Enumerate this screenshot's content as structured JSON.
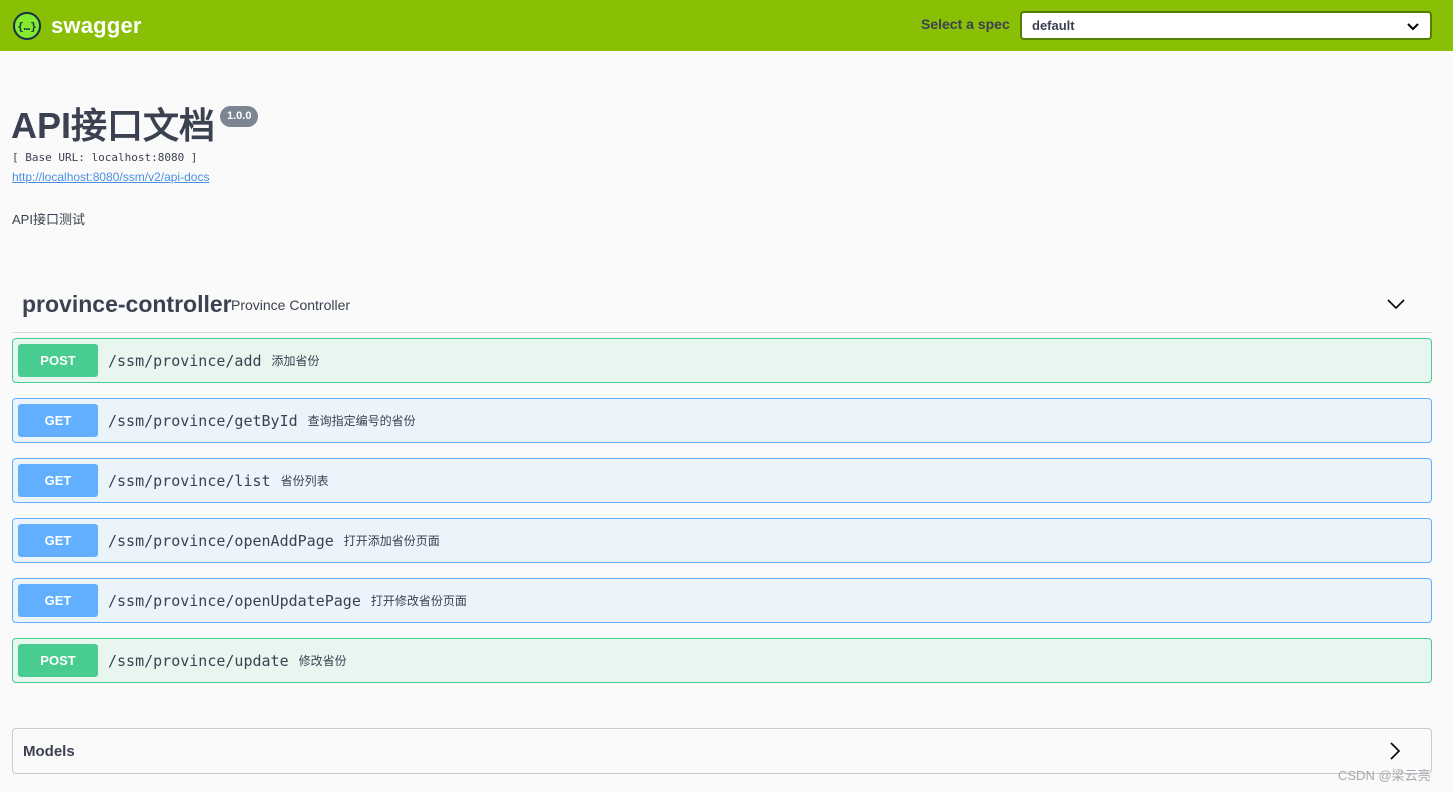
{
  "topbar": {
    "logo_text": "swagger",
    "spec_label": "Select a spec",
    "spec_value": "default"
  },
  "info": {
    "title": "API接口文档",
    "version": "1.0.0",
    "base_url": "[ Base URL: localhost:8080 ]",
    "docs_link": "http://localhost:8080/ssm/v2/api-docs",
    "description": "API接口测试"
  },
  "tag": {
    "name": "province-controller",
    "description": "Province Controller"
  },
  "operations": [
    {
      "method": "POST",
      "path": "/ssm/province/add",
      "summary": "添加省份"
    },
    {
      "method": "GET",
      "path": "/ssm/province/getById",
      "summary": "查询指定编号的省份"
    },
    {
      "method": "GET",
      "path": "/ssm/province/list",
      "summary": "省份列表"
    },
    {
      "method": "GET",
      "path": "/ssm/province/openAddPage",
      "summary": "打开添加省份页面"
    },
    {
      "method": "GET",
      "path": "/ssm/province/openUpdatePage",
      "summary": "打开修改省份页面"
    },
    {
      "method": "POST",
      "path": "/ssm/province/update",
      "summary": "修改省份"
    }
  ],
  "models": {
    "title": "Models"
  },
  "watermark": "CSDN @梁云亮",
  "colors": {
    "topbar": "#89bf04",
    "post": "#49cc90",
    "get": "#61affe"
  },
  "icons": {
    "logo": "swagger-logo-icon",
    "select": "chevron-down-icon",
    "tag": "chevron-down-icon",
    "models": "chevron-right-icon"
  }
}
